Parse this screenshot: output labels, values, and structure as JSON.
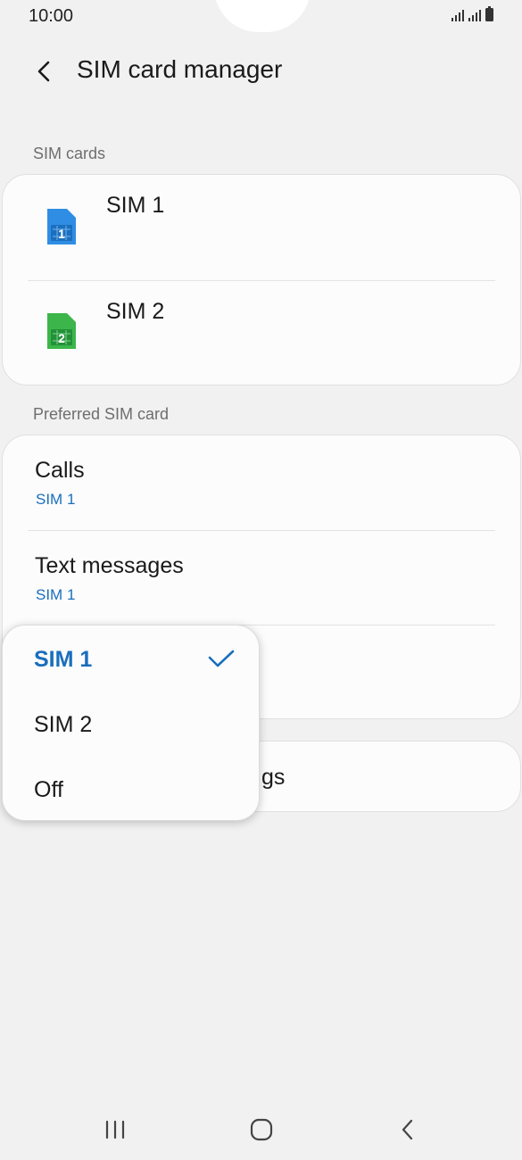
{
  "status_bar": {
    "time": "10:00",
    "icons": [
      "signal-icon",
      "signal-icon",
      "battery-icon"
    ]
  },
  "header": {
    "back_icon": "chevron-left-icon",
    "title": "SIM card manager"
  },
  "sim_cards": {
    "section_label": "SIM cards",
    "items": [
      {
        "name": "SIM 1",
        "badge": "1",
        "color": "#2f8de4",
        "icon": "sim-card-icon"
      },
      {
        "name": "SIM 2",
        "badge": "2",
        "color": "#3cb64a",
        "icon": "sim-card-icon"
      }
    ]
  },
  "preferred": {
    "section_label": "Preferred SIM card",
    "items": [
      {
        "title": "Calls",
        "value": "SIM 1"
      },
      {
        "title": "Text messages",
        "value": "SIM 1"
      }
    ]
  },
  "more_settings": {
    "partial_label": "gs"
  },
  "dropdown": {
    "options": [
      {
        "label": "SIM 1",
        "selected": true
      },
      {
        "label": "SIM 2",
        "selected": false
      },
      {
        "label": "Off",
        "selected": false
      }
    ],
    "check_icon": "checkmark-icon"
  },
  "nav_bar": {
    "buttons": [
      "recent-apps-icon",
      "home-icon",
      "back-icon"
    ]
  },
  "colors": {
    "accent": "#1a6ebd",
    "background": "#f1f1f1",
    "card": "#fcfcfc"
  }
}
